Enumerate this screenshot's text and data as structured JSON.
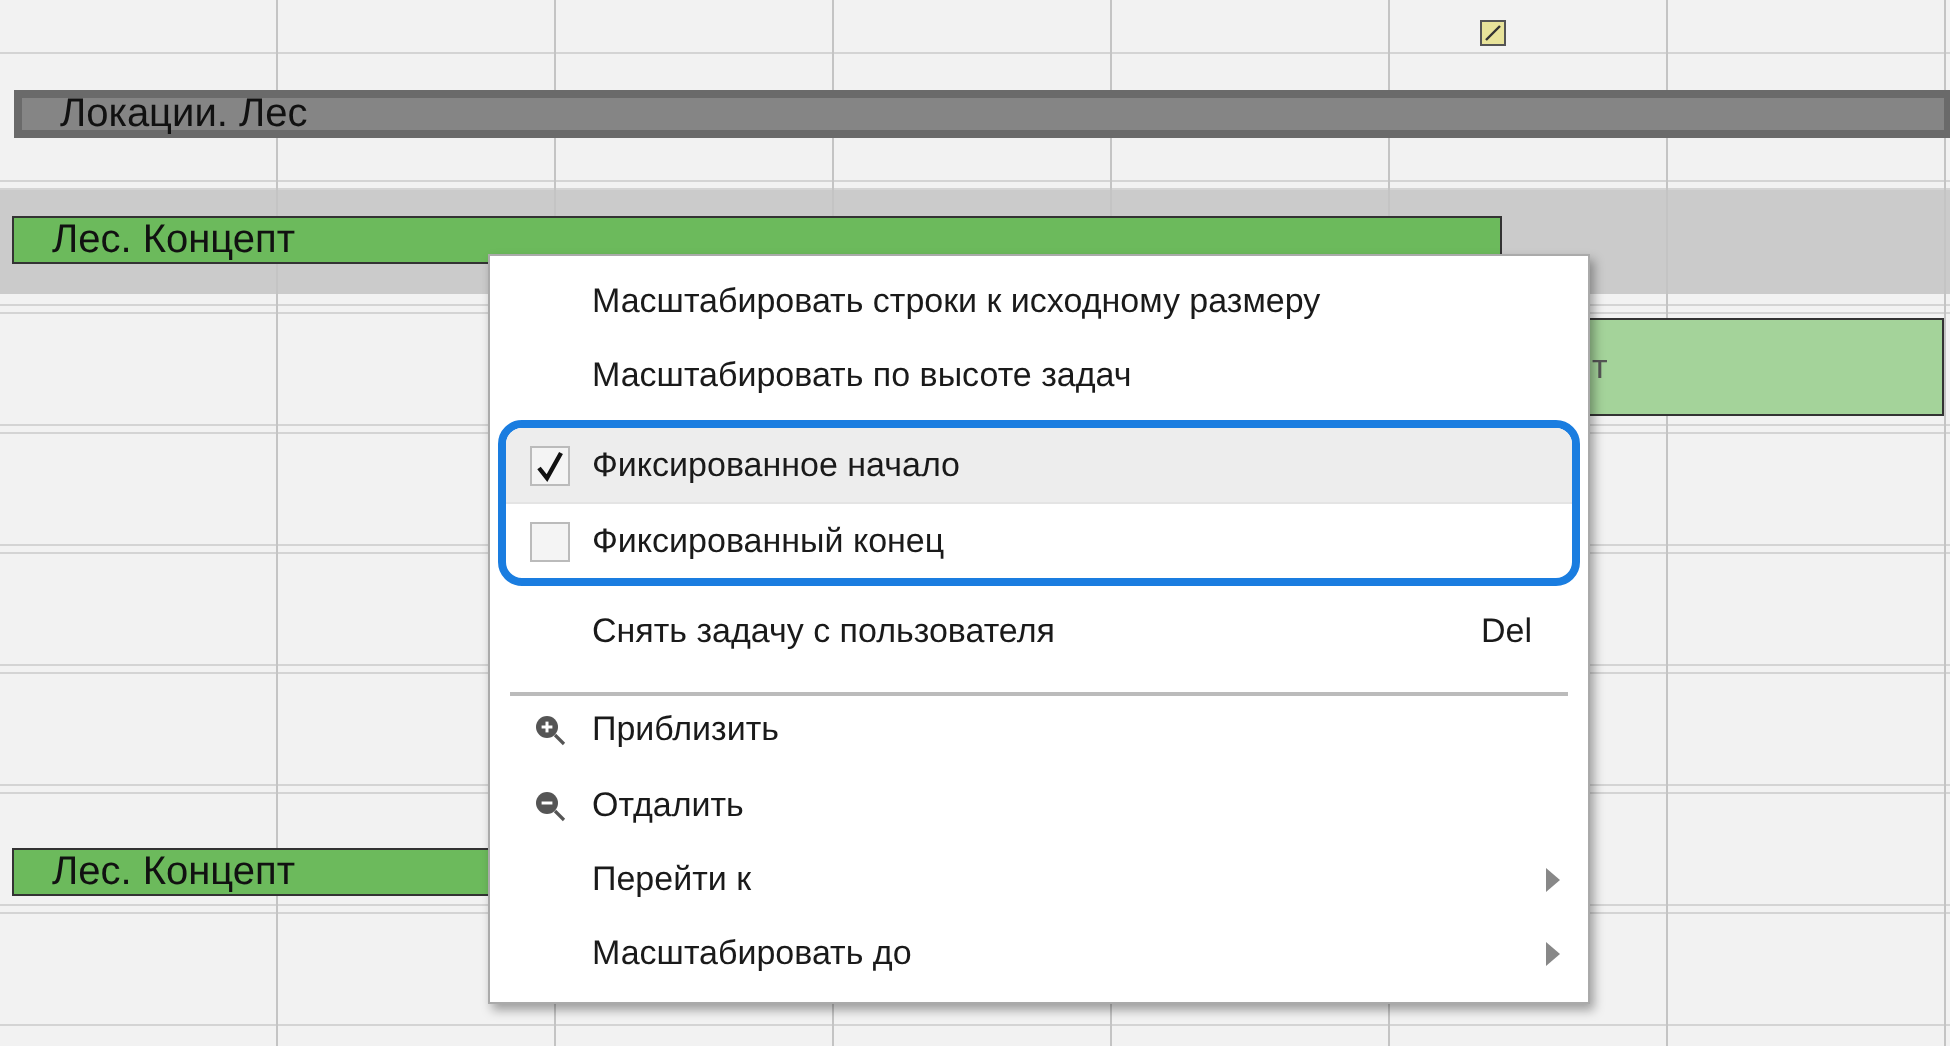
{
  "gantt": {
    "marker": {
      "kind": "note"
    },
    "bars": [
      {
        "kind": "group",
        "label": "Локации. Лес"
      },
      {
        "kind": "task",
        "label": "Лес. Концепт",
        "selected": true
      },
      {
        "kind": "task-light",
        "label": "т",
        "selected": false
      },
      {
        "kind": "task",
        "label": "Лес. Концепт",
        "selected": false
      }
    ]
  },
  "context_menu": {
    "groups": [
      {
        "framed": false,
        "divider_above": false,
        "items": [
          {
            "kind": "command",
            "label": "Масштабировать строки к исходному размеру",
            "hovered": false
          },
          {
            "kind": "command",
            "label": "Масштабировать по высоте задач",
            "hovered": false
          }
        ]
      },
      {
        "framed": true,
        "divider_above": false,
        "items": [
          {
            "kind": "check",
            "label": "Фиксированное начало",
            "checked": true,
            "hovered": true
          },
          {
            "kind": "check",
            "label": "Фиксированный конец",
            "checked": false,
            "hovered": false
          }
        ]
      },
      {
        "framed": false,
        "divider_above": false,
        "items": [
          {
            "kind": "command",
            "label": "Снять задачу с пользователя",
            "shortcut": "Del",
            "hovered": false
          }
        ]
      },
      {
        "framed": false,
        "divider_above": true,
        "items": [
          {
            "kind": "zoom-in",
            "label": "Приблизить",
            "hovered": false
          },
          {
            "kind": "zoom-out",
            "label": "Отдалить",
            "hovered": false
          },
          {
            "kind": "submenu",
            "label": "Перейти к",
            "hovered": false
          },
          {
            "kind": "submenu",
            "label": "Масштабировать до",
            "hovered": false
          }
        ]
      }
    ]
  }
}
